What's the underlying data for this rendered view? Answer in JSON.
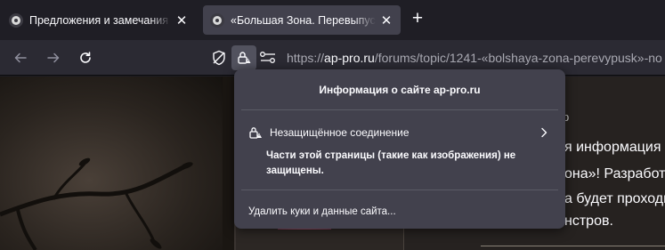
{
  "tabs": [
    {
      "title": "Предложения и замечания по",
      "close": "✕",
      "active": false
    },
    {
      "title": "«Большая Зона. Перевыпуск»",
      "close": "✕",
      "active": true
    }
  ],
  "newtab_icon": "+",
  "nav": {
    "back_icon": "arrow-left-icon",
    "forward_icon": "arrow-right-icon",
    "reload_icon": "reload-icon"
  },
  "urlbar": {
    "scheme": "https://",
    "host": "ap-pro.ru",
    "path": "/forums/topic/1241-«bolshaya-zona-perevypusk»-no"
  },
  "page": {
    "right_line1": "я информация с",
    "right_line2": "она»! Разработ",
    "right_line3": "а будет проходн",
    "right_line4": "нстров.",
    "right_small": "р"
  },
  "popup": {
    "title": "Информация о сайте ap-pro.ru",
    "connection_label": "Незащищённое соединение",
    "description": "Части этой страницы (такие как изображения) не защищены.",
    "clear_label": "Удалить куки и данные сайта..."
  },
  "colors": {
    "tabstrip_bg": "#1f1e25",
    "navbar_bg": "#2b2a33",
    "popup_bg": "#42414d",
    "text": "#fbfbfe",
    "url_dim": "#a9a9b2"
  }
}
